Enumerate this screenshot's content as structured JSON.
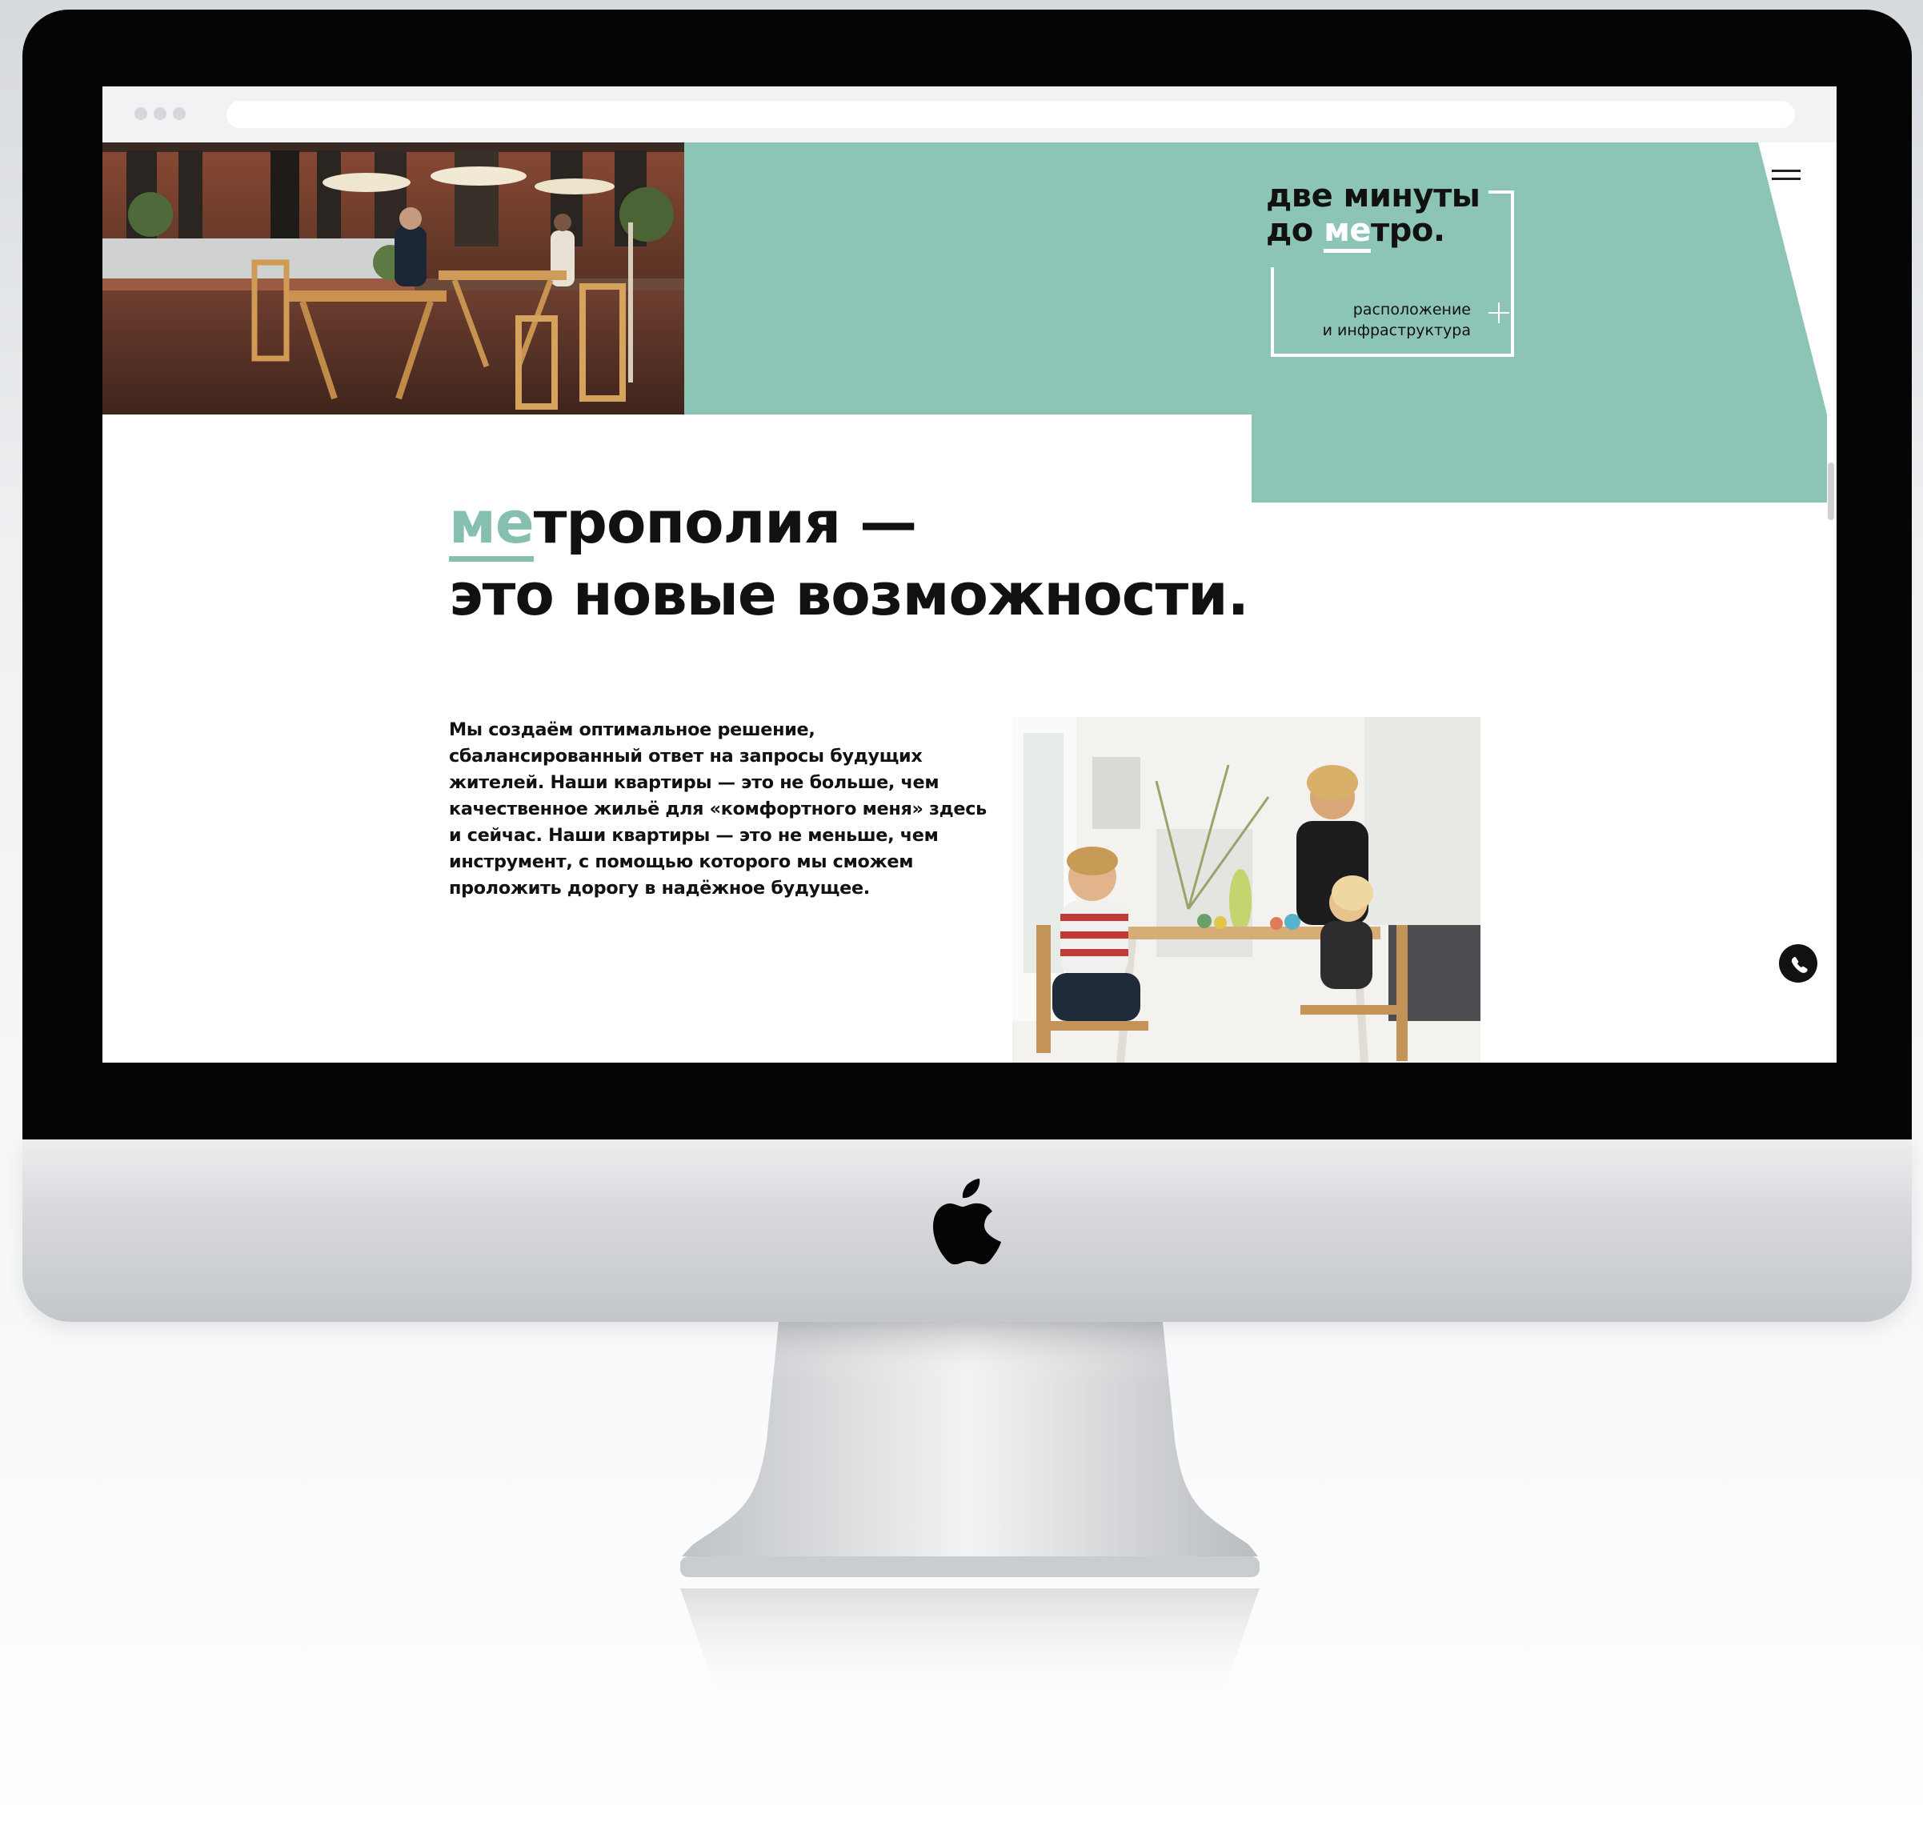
{
  "colors": {
    "accent_teal": "#8cc4b5",
    "heading_text": "#111111",
    "imac_bezel": "#050505",
    "imac_chin": "#d9dbde",
    "browser_bar": "#f1f2f3"
  },
  "icons": {
    "menu": "hamburger-menu-icon",
    "location_expand": "plus-icon",
    "callback": "phone-icon",
    "hardware_logo": "apple-logo-icon"
  },
  "hero": {
    "title_line1": "две минуты",
    "title_line2_prefix": "до ",
    "title_line2_accent": "ме",
    "title_line2_suffix": "тро.",
    "location_link_line1": "расположение",
    "location_link_line2": "и инфраструктура"
  },
  "main": {
    "heading_line1_accent": "ме",
    "heading_line1_rest": "трополия —",
    "heading_line2": "это новые возможности.",
    "body_text": "Мы создаём оптимальное решение,\nсбалансированный ответ на запросы будущих\nжителей. Наши квартиры — это не больше, чем\nкачественное жильё для «комфортного меня» здесь\nи сейчас. Наши квартиры — это не меньше, чем\nинструмент, с помощью которого мы сможем\nпроложить дорогу в надёжное будущее."
  }
}
